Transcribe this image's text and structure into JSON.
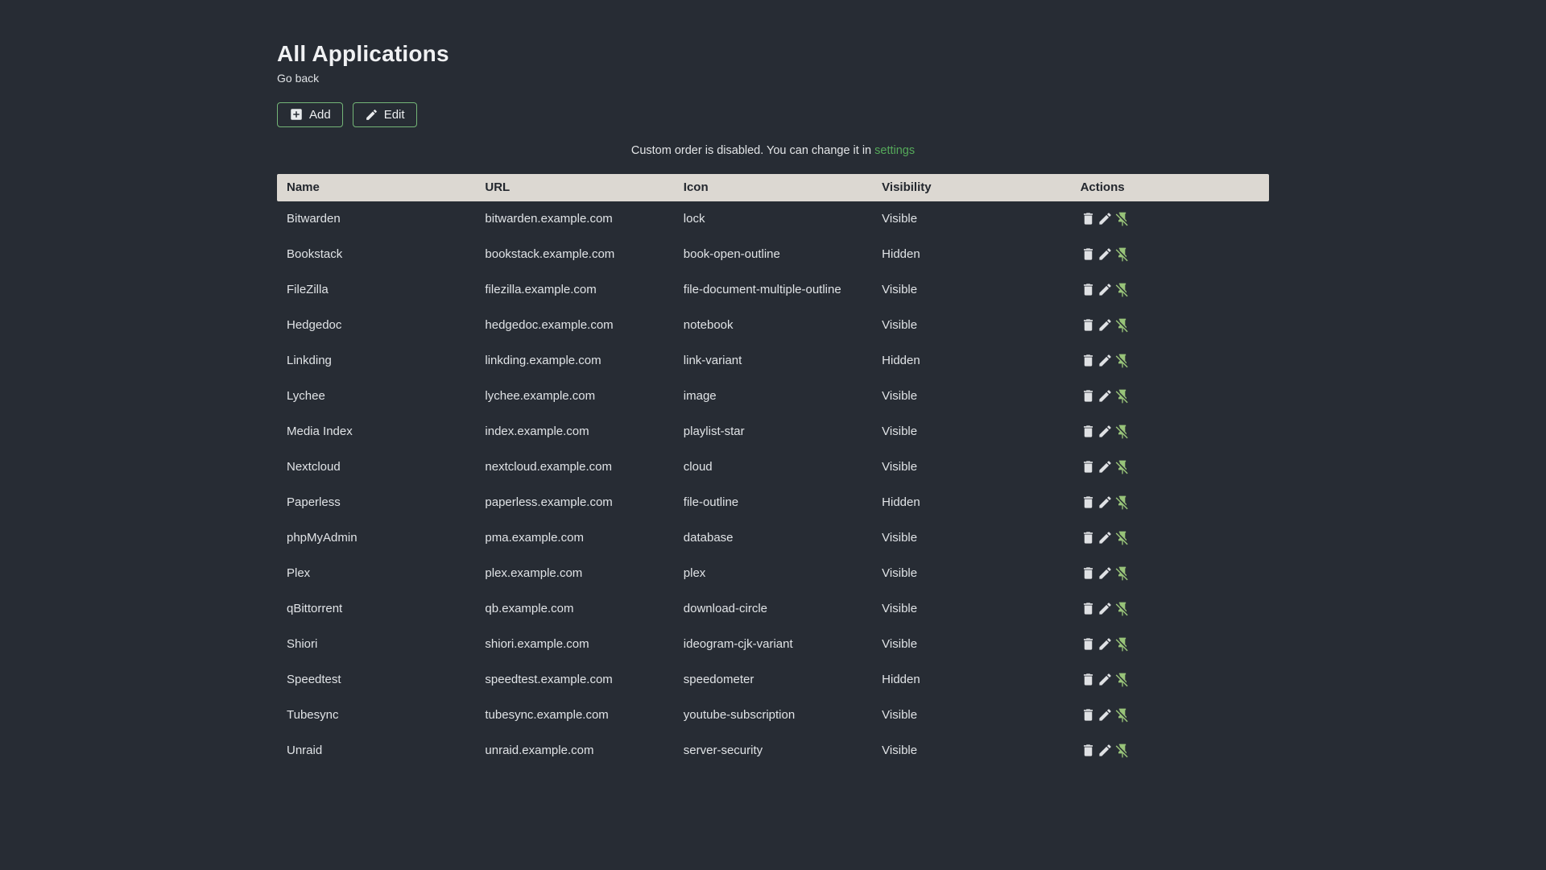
{
  "page": {
    "title": "All Applications",
    "back_link_label": "Go back",
    "add_button_label": "Add",
    "edit_button_label": "Edit",
    "notice_text": "Custom order is disabled. You can change it in ",
    "notice_link_label": "settings"
  },
  "colors": {
    "background": "#272c34",
    "table_header_bg": "#dcd8d2",
    "table_header_text": "#23272e",
    "row_text": "#e0e3e6",
    "accent_green_link": "#55a95a",
    "button_border_green": "#74b577",
    "pin_icon_green": "#98c379",
    "action_icon_light": "#dfe1e4"
  },
  "table": {
    "columns": [
      "Name",
      "URL",
      "Icon",
      "Visibility",
      "Actions"
    ],
    "row_actions": [
      "delete",
      "edit",
      "pin-off"
    ],
    "rows": [
      {
        "name": "Bitwarden",
        "url": "bitwarden.example.com",
        "icon": "lock",
        "visibility": "Visible"
      },
      {
        "name": "Bookstack",
        "url": "bookstack.example.com",
        "icon": "book-open-outline",
        "visibility": "Hidden"
      },
      {
        "name": "FileZilla",
        "url": "filezilla.example.com",
        "icon": "file-document-multiple-outline",
        "visibility": "Visible"
      },
      {
        "name": "Hedgedoc",
        "url": "hedgedoc.example.com",
        "icon": "notebook",
        "visibility": "Visible"
      },
      {
        "name": "Linkding",
        "url": "linkding.example.com",
        "icon": "link-variant",
        "visibility": "Hidden"
      },
      {
        "name": "Lychee",
        "url": "lychee.example.com",
        "icon": "image",
        "visibility": "Visible"
      },
      {
        "name": "Media Index",
        "url": "index.example.com",
        "icon": "playlist-star",
        "visibility": "Visible"
      },
      {
        "name": "Nextcloud",
        "url": "nextcloud.example.com",
        "icon": "cloud",
        "visibility": "Visible"
      },
      {
        "name": "Paperless",
        "url": "paperless.example.com",
        "icon": "file-outline",
        "visibility": "Hidden"
      },
      {
        "name": "phpMyAdmin",
        "url": "pma.example.com",
        "icon": "database",
        "visibility": "Visible"
      },
      {
        "name": "Plex",
        "url": "plex.example.com",
        "icon": "plex",
        "visibility": "Visible"
      },
      {
        "name": "qBittorrent",
        "url": "qb.example.com",
        "icon": "download-circle",
        "visibility": "Visible"
      },
      {
        "name": "Shiori",
        "url": "shiori.example.com",
        "icon": "ideogram-cjk-variant",
        "visibility": "Visible"
      },
      {
        "name": "Speedtest",
        "url": "speedtest.example.com",
        "icon": "speedometer",
        "visibility": "Hidden"
      },
      {
        "name": "Tubesync",
        "url": "tubesync.example.com",
        "icon": "youtube-subscription",
        "visibility": "Visible"
      },
      {
        "name": "Unraid",
        "url": "unraid.example.com",
        "icon": "server-security",
        "visibility": "Visible"
      }
    ]
  }
}
